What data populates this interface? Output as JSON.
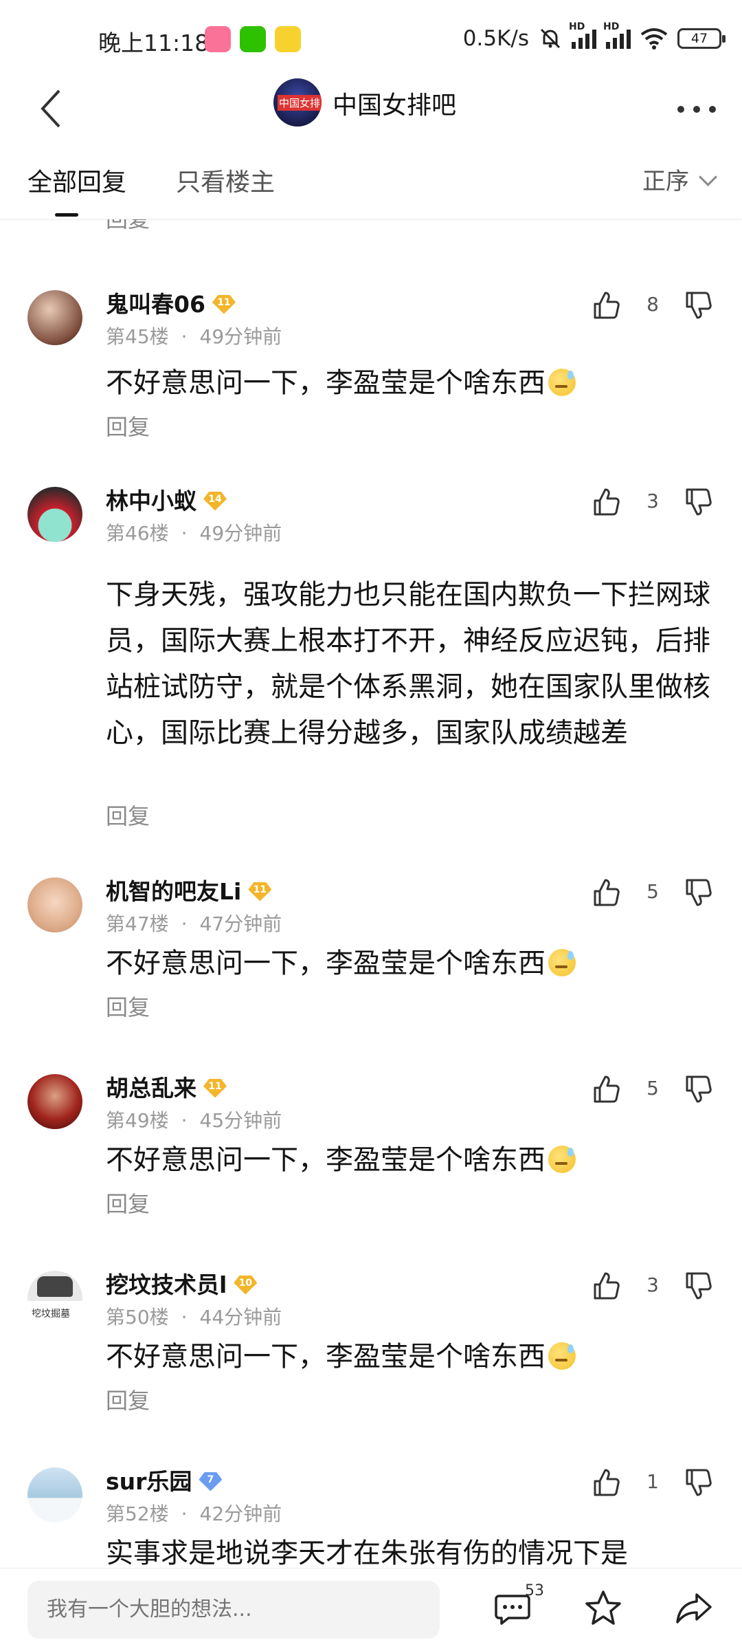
{
  "status_bar": {
    "time": "晚上11:18",
    "net_speed": "0.5K/s",
    "battery": "47",
    "app_icons": [
      "bilibili-icon",
      "wechat-icon",
      "app-bee-icon"
    ]
  },
  "header": {
    "title": "中国女排吧",
    "logo_text": "中国女排"
  },
  "tabs": {
    "all": "全部回复",
    "op_only": "只看楼主",
    "sort": "正序"
  },
  "list": {
    "prev_reply": "回复",
    "comments": [
      {
        "user": "鬼叫春06",
        "level": "11",
        "floor": "第45楼",
        "time": "49分钟前",
        "likes": "8",
        "text": "不好意思问一下，李盈莹是个啥东西",
        "reply": "回复"
      },
      {
        "user": "林中小蚁",
        "level": "14",
        "floor": "第46楼",
        "time": "49分钟前",
        "likes": "3",
        "text": "下身天残，强攻能力也只能在国内欺负一下拦网球员，国际大赛上根本打不开，神经反应迟钝，后排站桩试防守，就是个体系黑洞，她在国家队里做核心，国际比赛上得分越多，国家队成绩越差",
        "reply": "回复"
      },
      {
        "user": "机智的吧友Li",
        "level": "11",
        "floor": "第47楼",
        "time": "47分钟前",
        "likes": "5",
        "text": "不好意思问一下，李盈莹是个啥东西",
        "reply": "回复"
      },
      {
        "user": "胡总乱来",
        "level": "11",
        "floor": "第49楼",
        "time": "45分钟前",
        "likes": "5",
        "text": "不好意思问一下，李盈莹是个啥东西",
        "reply": "回复"
      },
      {
        "user": "挖坟技术员l",
        "level": "10",
        "floor": "第50楼",
        "time": "44分钟前",
        "likes": "3",
        "text": "不好意思问一下，李盈莹是个啥东西",
        "reply": "回复",
        "avatar_text": "挖坟掘墓"
      },
      {
        "user": "sur乐园",
        "level": "7",
        "floor": "第52楼",
        "time": "42分钟前",
        "likes": "1",
        "text": "实事求是地说李天才在朱张有伤的情况下是"
      }
    ]
  },
  "bottom_bar": {
    "placeholder": "我有一个大胆的想法...",
    "reply_count": "53"
  },
  "colors": {
    "text": "#141414",
    "secondary": "#8a8a8a",
    "level_badge": "#f3b52a",
    "level_badge_blue": "#6a9df0"
  }
}
